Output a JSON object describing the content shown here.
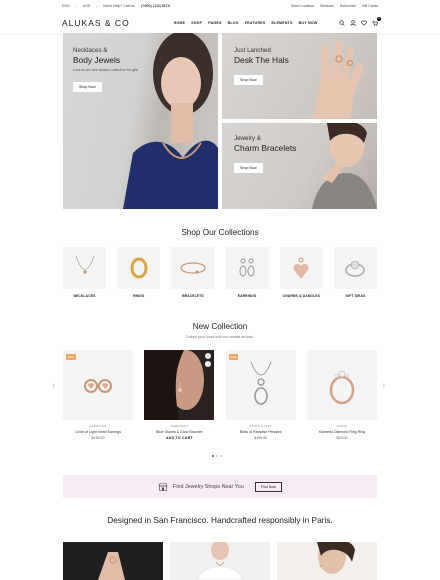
{
  "topbar": {
    "language": "ENG",
    "currency": "USD",
    "help": "Need Help? Call us:",
    "phone": "(+800) 1234 5678",
    "links": [
      "Store Location",
      "Services",
      "Subscribe",
      "Gift Cards"
    ]
  },
  "header": {
    "logo": "ALUKAS & CO",
    "nav": [
      "HOME",
      "SHOP",
      "PAGES",
      "BLOG",
      "FEATURES",
      "ELEMENTS",
      "BUY NOW"
    ],
    "cart_count": "1",
    "icons": [
      "search-icon",
      "user-icon",
      "heart-icon",
      "cart-icon"
    ]
  },
  "hero": {
    "b1": {
      "small": "Necklaces &",
      "big": "Body Jewels",
      "sub": "Look at our new season collection for girls",
      "button": "Shop Now"
    },
    "b2": {
      "small": "Just Lanched",
      "big": "Desk The Hals",
      "button": "Shop Now"
    },
    "b3": {
      "small": "Jewelry &",
      "big": "Charm Bracelets",
      "button": "Shop Now"
    }
  },
  "collections": {
    "title": "Shop Our Collections",
    "items": [
      "NECKLACES",
      "RINGS",
      "BRACELETS",
      "EARRINGS",
      "CHARMS & DANGLES",
      "GIFT IDEAS"
    ]
  },
  "new_collection": {
    "title": "New Collection",
    "subtitle": "Collect your loves with our newest arrivals.",
    "products": [
      {
        "badge": "Sale",
        "category": "EARRINGS",
        "name": "Circle of Light Heart Earrings",
        "price": "$139.00"
      },
      {
        "badge": "",
        "category": "EARRINGS",
        "name": "Blue Shores & Glow Bracelet",
        "action": "ADD TO CART"
      },
      {
        "badge": "Sale",
        "category": "PARTS & KITS",
        "name": "Birds of Paradise Pendant",
        "price": "$199.00"
      },
      {
        "badge": "",
        "category": "RINGS",
        "name": "Kalmeria Diamond Ring Ring",
        "price": "$29.00"
      }
    ]
  },
  "find": {
    "text": "Find Jewelry Shops Near You",
    "button": "Find Now"
  },
  "designed": "Designed in San Francisco. Handcrafted responsibly in Paris.",
  "colors": {
    "sale_badge": "#f0a766",
    "find_bar": "#f7ebf4",
    "gold": "#c89872"
  }
}
